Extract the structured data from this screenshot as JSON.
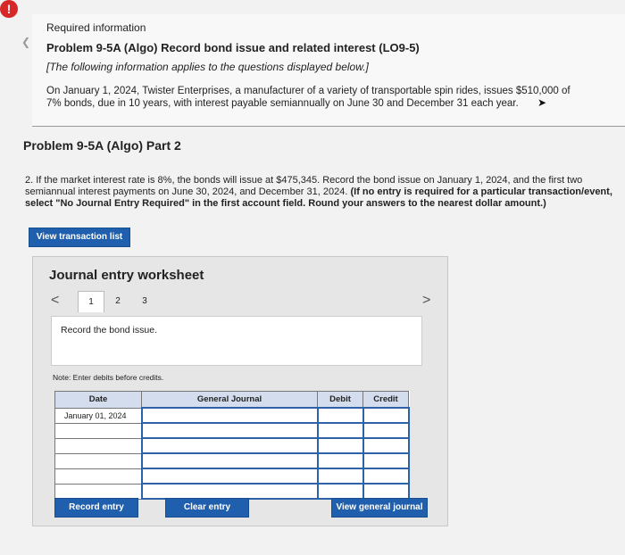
{
  "alert": {
    "symbol": "!"
  },
  "header": {
    "required_info": "Required information",
    "problem_title": "Problem 9-5A (Algo) Record bond issue and related interest (LO9-5)",
    "applies_note": "[The following information applies to the questions displayed below.]",
    "intro": "On January 1, 2024, Twister Enterprises, a manufacturer of a variety of transportable spin rides, issues $510,000 of 7% bonds, due in 10 years, with interest payable semiannually on June 30 and December 31 each year."
  },
  "part": {
    "title": "Problem 9-5A (Algo) Part 2",
    "question_text": "2. If the market interest rate is 8%, the bonds will issue at $475,345. Record the bond issue on January 1, 2024, and the first two semiannual interest payments on June 30, 2024, and December 31, 2024.",
    "question_bold": "(If no entry is required for a particular transaction/event, select \"No Journal Entry Required\" in the first account field. Round your answers to the nearest dollar amount.)"
  },
  "buttons": {
    "view_transaction_list": "View transaction list",
    "record_entry": "Record entry",
    "clear_entry": "Clear entry",
    "view_general_journal": "View general journal"
  },
  "worksheet": {
    "title": "Journal entry worksheet",
    "prev": "<",
    "next": ">",
    "tabs": [
      "1",
      "2",
      "3"
    ],
    "instruction": "Record the bond issue.",
    "note": "Note: Enter debits before credits.",
    "columns": {
      "date": "Date",
      "account": "General Journal",
      "debit": "Debit",
      "credit": "Credit"
    },
    "rows": [
      {
        "date": "January 01, 2024"
      },
      {
        "date": ""
      },
      {
        "date": ""
      },
      {
        "date": ""
      },
      {
        "date": ""
      },
      {
        "date": ""
      }
    ]
  }
}
